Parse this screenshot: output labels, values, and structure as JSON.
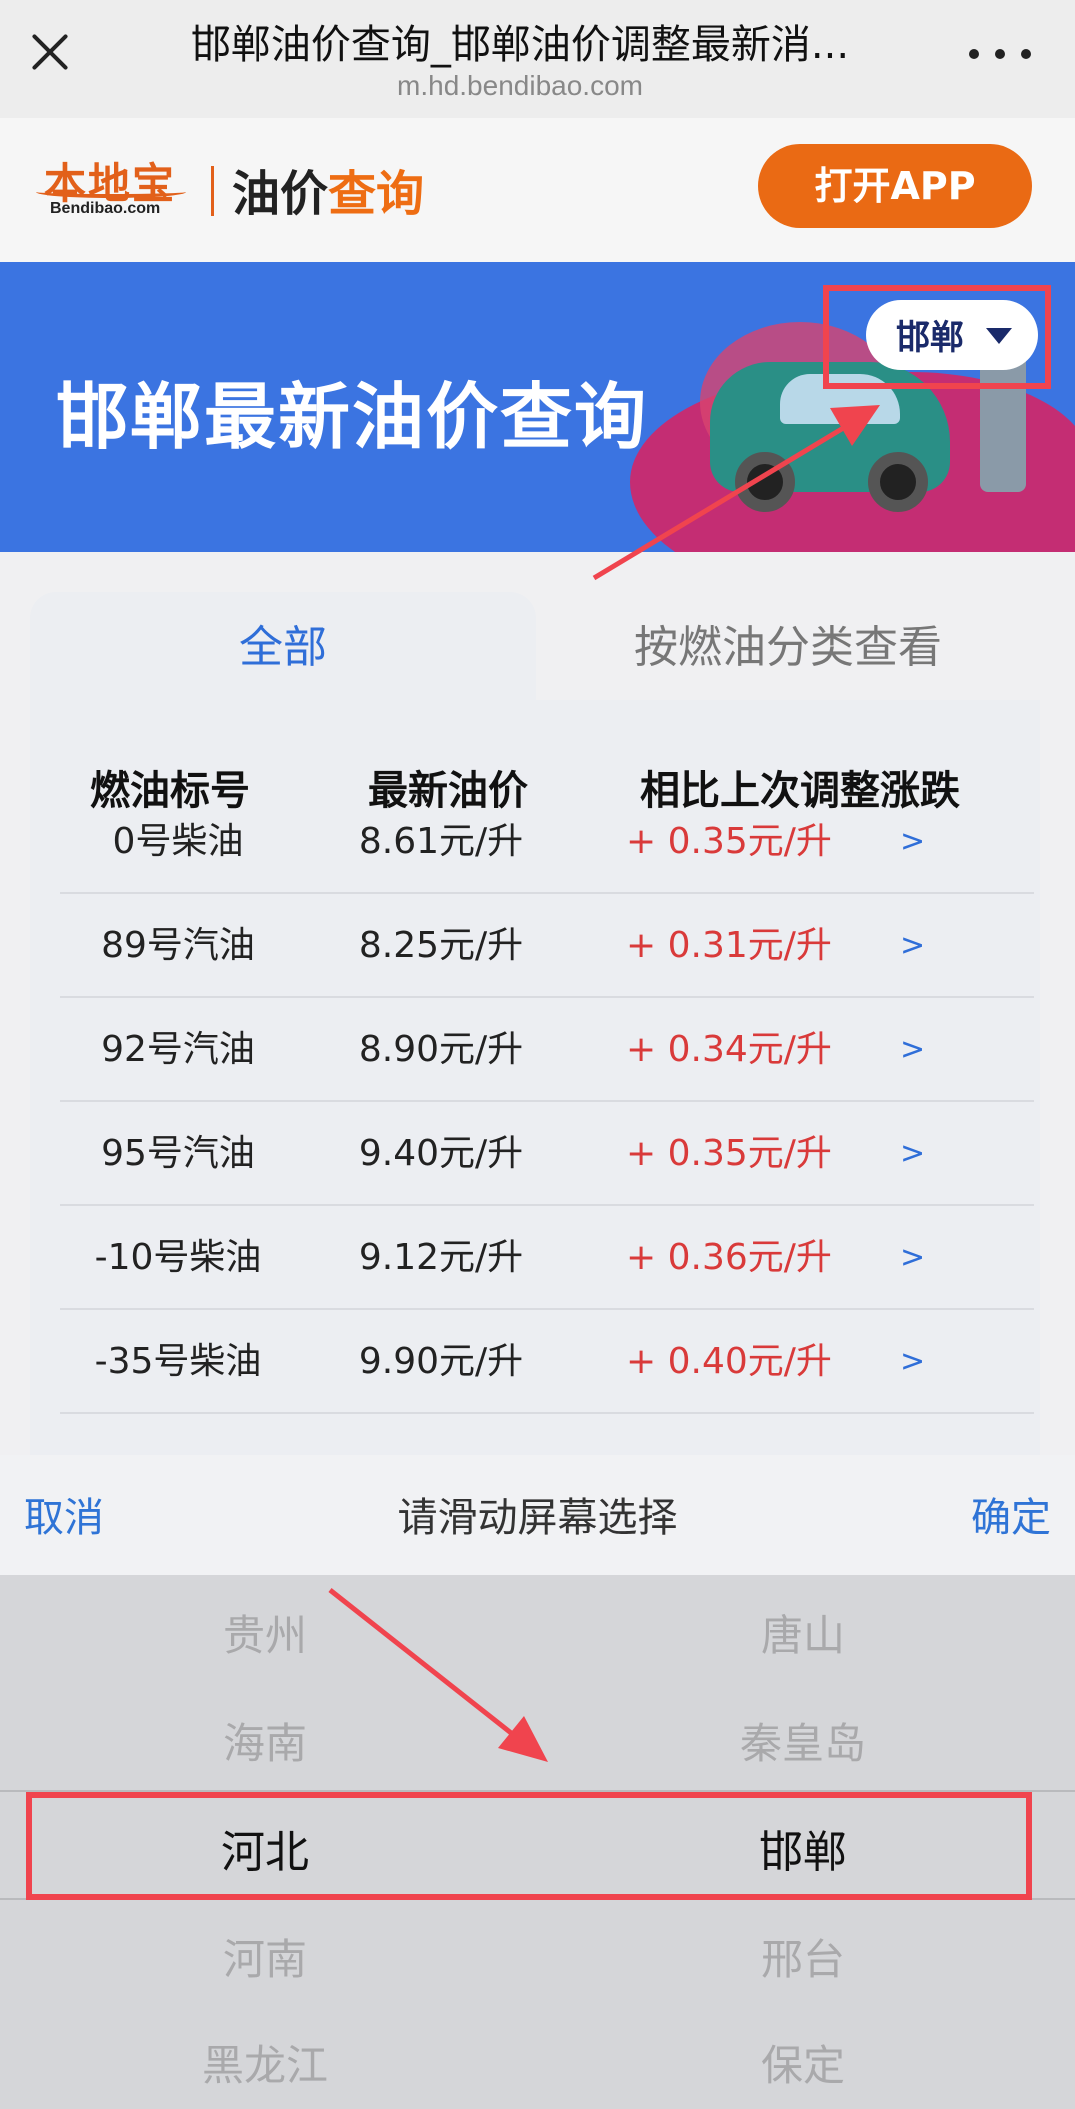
{
  "browser": {
    "title": "邯郸油价查询_邯郸油价调整最新消...",
    "url": "m.hd.bendibao.com"
  },
  "site": {
    "logo_cn": "本地宝",
    "logo_en": "Bendibao.com",
    "section_dark": "油价",
    "section_orange": "查询",
    "open_app": "打开APP"
  },
  "banner": {
    "title": "邯郸最新油价查询",
    "city": "邯郸"
  },
  "tabs": [
    {
      "label": "全部",
      "active": true
    },
    {
      "label": "按燃油分类查看",
      "active": false
    }
  ],
  "table": {
    "headers": [
      "燃油标号",
      "最新油价",
      "相比上次调整涨跌"
    ],
    "rows": [
      {
        "name": "0号柴油",
        "price": "8.61元/升",
        "change": "+ 0.35元/升",
        "arrow": ">"
      },
      {
        "name": "89号汽油",
        "price": "8.25元/升",
        "change": "+ 0.31元/升",
        "arrow": ">"
      },
      {
        "name": "92号汽油",
        "price": "8.90元/升",
        "change": "+ 0.34元/升",
        "arrow": ">"
      },
      {
        "name": "95号汽油",
        "price": "9.40元/升",
        "change": "+ 0.35元/升",
        "arrow": ">"
      },
      {
        "name": "-10号柴油",
        "price": "9.12元/升",
        "change": "+ 0.36元/升",
        "arrow": ">"
      },
      {
        "name": "-35号柴油",
        "price": "9.90元/升",
        "change": "+ 0.40元/升",
        "arrow": ">"
      }
    ]
  },
  "picker": {
    "cancel": "取消",
    "title": "请滑动屏幕选择",
    "confirm": "确定",
    "provinces": [
      "贵州",
      "海南",
      "河北",
      "河南",
      "黑龙江"
    ],
    "cities": [
      "唐山",
      "秦皇岛",
      "邯郸",
      "邢台",
      "保定"
    ],
    "selected_province": "河北",
    "selected_city": "邯郸"
  },
  "colors": {
    "accent_blue": "#2f6ed8",
    "banner_blue": "#3b74e1",
    "brand_orange": "#ea6a14",
    "increase_red": "#d93a3a",
    "annotation_red": "#f0444e"
  }
}
